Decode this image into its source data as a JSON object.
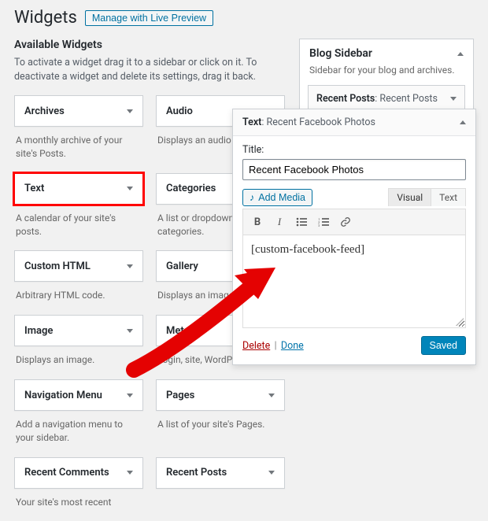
{
  "header": {
    "title": "Widgets",
    "live_preview_btn": "Manage with Live Preview"
  },
  "available": {
    "heading": "Available Widgets",
    "desc": "To activate a widget drag it to a sidebar or click on it. To deactivate a widget and delete its settings, drag it back.",
    "widgets": [
      {
        "name": "Archives",
        "desc": "A monthly archive of your site's Posts."
      },
      {
        "name": "Audio",
        "desc": "Displays an audio player."
      },
      {
        "name": "Text",
        "desc": "A calendar of your site's posts.",
        "highlight": true
      },
      {
        "name": "Categories",
        "desc": "A list or dropdown of categories."
      },
      {
        "name": "Custom HTML",
        "desc": "Arbitrary HTML code."
      },
      {
        "name": "Gallery",
        "desc": "Displays an image gallery."
      },
      {
        "name": "Image",
        "desc": "Displays an image."
      },
      {
        "name": "Meta",
        "desc": "Login, site, WordPress links."
      },
      {
        "name": "Navigation Menu",
        "desc": "Add a navigation menu to your sidebar."
      },
      {
        "name": "Pages",
        "desc": "A list of your site's Pages."
      },
      {
        "name": "Recent Comments",
        "desc": "Your site's most recent"
      },
      {
        "name": "Recent Posts",
        "desc": ""
      }
    ]
  },
  "sidebar_area": {
    "title": "Blog Sidebar",
    "desc": "Sidebar for your blog and archives.",
    "placed": {
      "type": "Recent Posts",
      "title": "Recent Posts"
    }
  },
  "editor": {
    "header_type": "Text",
    "header_title": "Recent Facebook Photos",
    "title_label": "Title:",
    "title_value": "Recent Facebook Photos",
    "add_media": "Add Media",
    "tabs": {
      "visual": "Visual",
      "text": "Text"
    },
    "content": "[custom-facebook-feed]",
    "delete": "Delete",
    "done": "Done",
    "saved": "Saved"
  },
  "icons": {
    "music_note": "♪",
    "bold": "B",
    "italic": "I",
    "link": "🔗"
  }
}
